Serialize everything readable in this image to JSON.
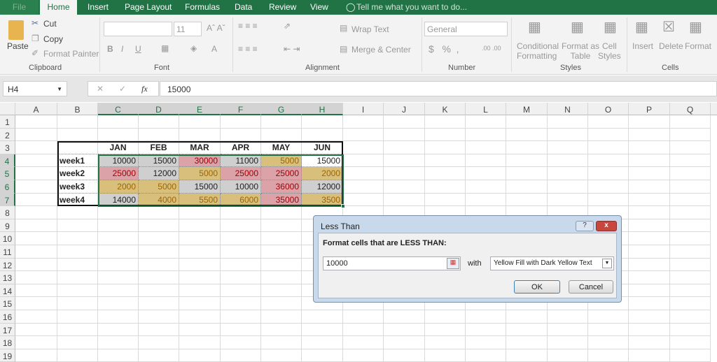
{
  "tabs": [
    "File",
    "Home",
    "Insert",
    "Page Layout",
    "Formulas",
    "Data",
    "Review",
    "View"
  ],
  "tell_me": "Tell me what you want to do...",
  "ribbon": {
    "clipboard": {
      "paste": "Paste",
      "cut": "Cut",
      "copy": "Copy",
      "format_painter": "Format Painter",
      "group": "Clipboard"
    },
    "font": {
      "font_size": "11",
      "group": "Font"
    },
    "alignment": {
      "wrap_text": "Wrap Text",
      "merge_center": "Merge & Center",
      "group": "Alignment"
    },
    "number": {
      "format": "General",
      "group": "Number"
    },
    "styles": {
      "conditional": "Conditional",
      "formatting": "Formatting",
      "format_as": "Format as",
      "table": "Table",
      "cell": "Cell",
      "styles": "Styles",
      "group": "Styles"
    },
    "cells": {
      "insert": "Insert",
      "delete": "Delete",
      "format": "Format",
      "group": "Cells"
    }
  },
  "formula_bar": {
    "name_box": "H4",
    "fx": "fx",
    "value": "15000"
  },
  "columns": [
    "A",
    "B",
    "C",
    "D",
    "E",
    "F",
    "G",
    "H",
    "I",
    "J",
    "K",
    "L",
    "M",
    "N",
    "O",
    "P",
    "Q"
  ],
  "rows": [
    "1",
    "2",
    "3",
    "4",
    "5",
    "6",
    "7",
    "8",
    "9",
    "10",
    "11",
    "12",
    "13",
    "14",
    "15",
    "16",
    "17",
    "18",
    "19"
  ],
  "table": {
    "headers": [
      "JAN",
      "FEB",
      "MAR",
      "APR",
      "MAY",
      "JUN"
    ],
    "rows": [
      {
        "label": "week1",
        "values": [
          "10000",
          "15000",
          "30000",
          "11000",
          "5000",
          "15000"
        ],
        "formats": [
          "gray",
          "gray",
          "red",
          "gray",
          "yellow",
          "none"
        ]
      },
      {
        "label": "week2",
        "values": [
          "25000",
          "12000",
          "5000",
          "25000",
          "25000",
          "2000"
        ],
        "formats": [
          "red",
          "gray",
          "yellow",
          "red",
          "red",
          "yellow"
        ]
      },
      {
        "label": "week3",
        "values": [
          "2000",
          "5000",
          "15000",
          "10000",
          "36000",
          "12000"
        ],
        "formats": [
          "yellow",
          "yellow",
          "gray",
          "gray",
          "red",
          "gray"
        ]
      },
      {
        "label": "week4",
        "values": [
          "14000",
          "4000",
          "5500",
          "6000",
          "35000",
          "3500"
        ],
        "formats": [
          "gray",
          "yellow",
          "yellow",
          "yellow",
          "red",
          "yellow"
        ]
      }
    ]
  },
  "colors": {
    "accent": "#217346",
    "gray_fill": "#cfcfcf",
    "red_fill": "#dba3a8",
    "red_text": "#9c0006",
    "yellow_fill": "#d8c07c",
    "yellow_text": "#9c6500"
  },
  "dialog": {
    "title": "Less Than",
    "help": "?",
    "close": "x",
    "prompt": "Format cells that are LESS THAN:",
    "value": "10000",
    "with": "with",
    "format": "Yellow Fill with Dark Yellow Text",
    "ok": "OK",
    "cancel": "Cancel"
  }
}
